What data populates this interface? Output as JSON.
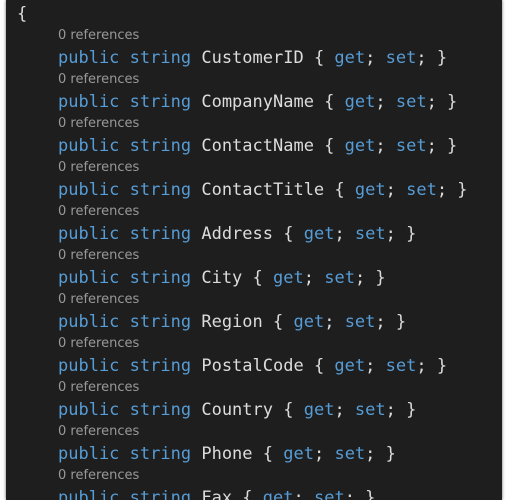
{
  "editor": {
    "open_brace": "{",
    "keyword_public": "public",
    "keyword_string": "string",
    "accessor_get": "get",
    "accessor_set": "set",
    "colors": {
      "background": "#1e1e1e",
      "keyword": "#569cd6",
      "text": "#dcdcdc",
      "codelens": "#999999"
    },
    "properties": [
      {
        "references": "0 references",
        "name": "CustomerID"
      },
      {
        "references": "0 references",
        "name": "CompanyName"
      },
      {
        "references": "0 references",
        "name": "ContactName"
      },
      {
        "references": "0 references",
        "name": "ContactTitle"
      },
      {
        "references": "0 references",
        "name": "Address"
      },
      {
        "references": "0 references",
        "name": "City"
      },
      {
        "references": "0 references",
        "name": "Region"
      },
      {
        "references": "0 references",
        "name": "PostalCode"
      },
      {
        "references": "0 references",
        "name": "Country"
      },
      {
        "references": "0 references",
        "name": "Phone"
      },
      {
        "references": "0 references",
        "name": "Fax"
      }
    ]
  }
}
